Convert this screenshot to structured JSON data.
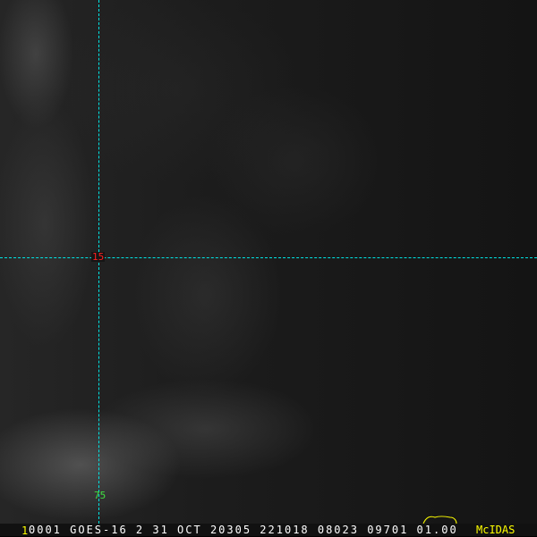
{
  "map": {
    "latitude_label": "15",
    "longitude_label": "75",
    "grid_color": "#00e5e5",
    "latitude_label_color": "#ff2020",
    "longitude_label_color": "#40e040",
    "coastline_color": "#ffff00"
  },
  "status_bar": {
    "frame_number": "1",
    "info": "0001 GOES-16     2 31 OCT 20305 221018 08023 09701 01.00",
    "brand": "McIDAS"
  }
}
